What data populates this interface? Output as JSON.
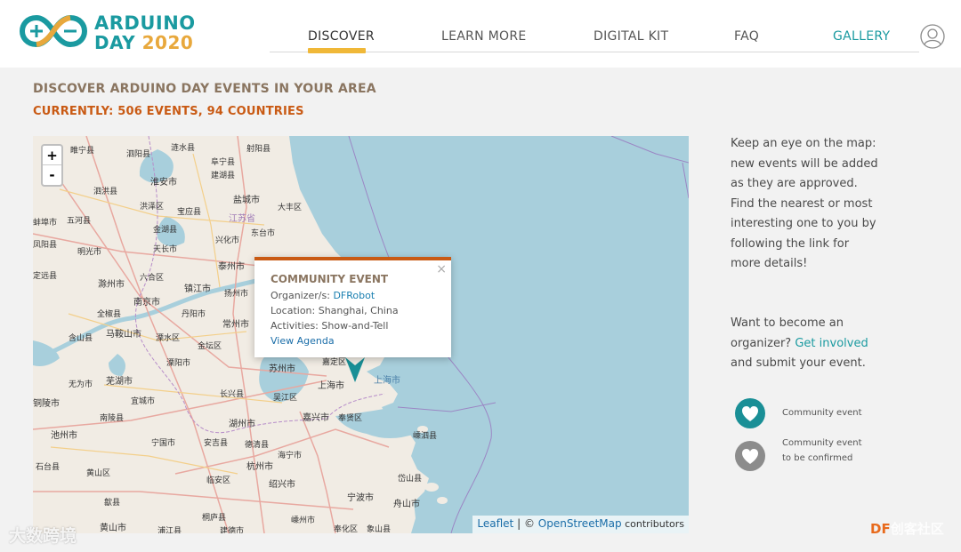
{
  "brand": {
    "line1": "ARDUINO",
    "line2": "DAY",
    "year": "2020",
    "colors": {
      "teal": "#1a9aa0",
      "orange": "#e8a83c"
    }
  },
  "nav": {
    "items": [
      {
        "label": "DISCOVER",
        "active": true
      },
      {
        "label": "LEARN MORE"
      },
      {
        "label": "DIGITAL KIT"
      },
      {
        "label": "FAQ"
      },
      {
        "label": "GALLERY"
      }
    ],
    "avatar_icon": "user-icon"
  },
  "heading": {
    "title": "DISCOVER ARDUINO DAY EVENTS IN YOUR AREA",
    "count": "CURRENTLY: 506 EVENTS, 94 COUNTRIES"
  },
  "map": {
    "zoom_in": "+",
    "zoom_out": "-",
    "places": [
      "睢宁县",
      "泗阳县",
      "涟水县",
      "射阳县",
      "阜宁县",
      "建湖县",
      "淮安市",
      "泗洪县",
      "盐城市",
      "洪泽区",
      "宝应县",
      "大丰区",
      "蚌埠市",
      "五河县",
      "金湖县",
      "江苏省",
      "东台市",
      "凤阳县",
      "明光市",
      "天长市",
      "兴化市",
      "泰州市",
      "定远县",
      "滁州市",
      "六合区",
      "镇江市",
      "扬州市",
      "南京市",
      "丹阳市",
      "全椒县",
      "常州市",
      "马鞍山市",
      "溧水区",
      "含山县",
      "金坛区",
      "芜湖市",
      "溧阳市",
      "无为市",
      "宜城市",
      "苏州市",
      "长兴县",
      "上海市",
      "嘉定区",
      "吴江区",
      "嘉兴市",
      "铜陵市",
      "南陵县",
      "湖州市",
      "奉贤区",
      "池州市",
      "宁国市",
      "安吉县",
      "德清县",
      "海宁市",
      "嵊泗县",
      "石台县",
      "黄山区",
      "杭州市",
      "绍兴市",
      "岱山县",
      "歙县",
      "临安区",
      "舟山市",
      "宁波市",
      "黄山市",
      "桐庐县",
      "嵊州市",
      "奉化区",
      "象山县",
      "浦江县",
      "建德市"
    ],
    "sea_label": "上海市",
    "attribution": {
      "leaflet": "Leaflet",
      "sep": " | © ",
      "osm": "OpenStreetMap",
      "contrib": " contributors"
    }
  },
  "popup": {
    "close": "×",
    "title": "COMMUNITY EVENT",
    "organizer_label": "Organizer/s: ",
    "organizer": "DFRobot",
    "location": "Location: Shanghai, China",
    "activities": "Activities: Show-and-Tell",
    "link": "View Agenda"
  },
  "sidebar": {
    "p1": "Keep an eye on the map: new events will be added as they are approved. Find the nearest or most interesting one to you by following the link for more details!",
    "p2_pre": "Want to become an organizer? ",
    "p2_link": "Get involved",
    "p2_post": " and submit your event.",
    "legend": [
      {
        "label": "Community event",
        "color": "#1a8f96",
        "icon": "heart-icon"
      },
      {
        "label_1": "Community event",
        "label_2": "to be confirmed",
        "color": "#8c8c8c",
        "icon": "heart-icon"
      }
    ]
  },
  "watermarks": {
    "left": "大数跨境",
    "right_df": "DF",
    "right_rest": "创客社区"
  }
}
